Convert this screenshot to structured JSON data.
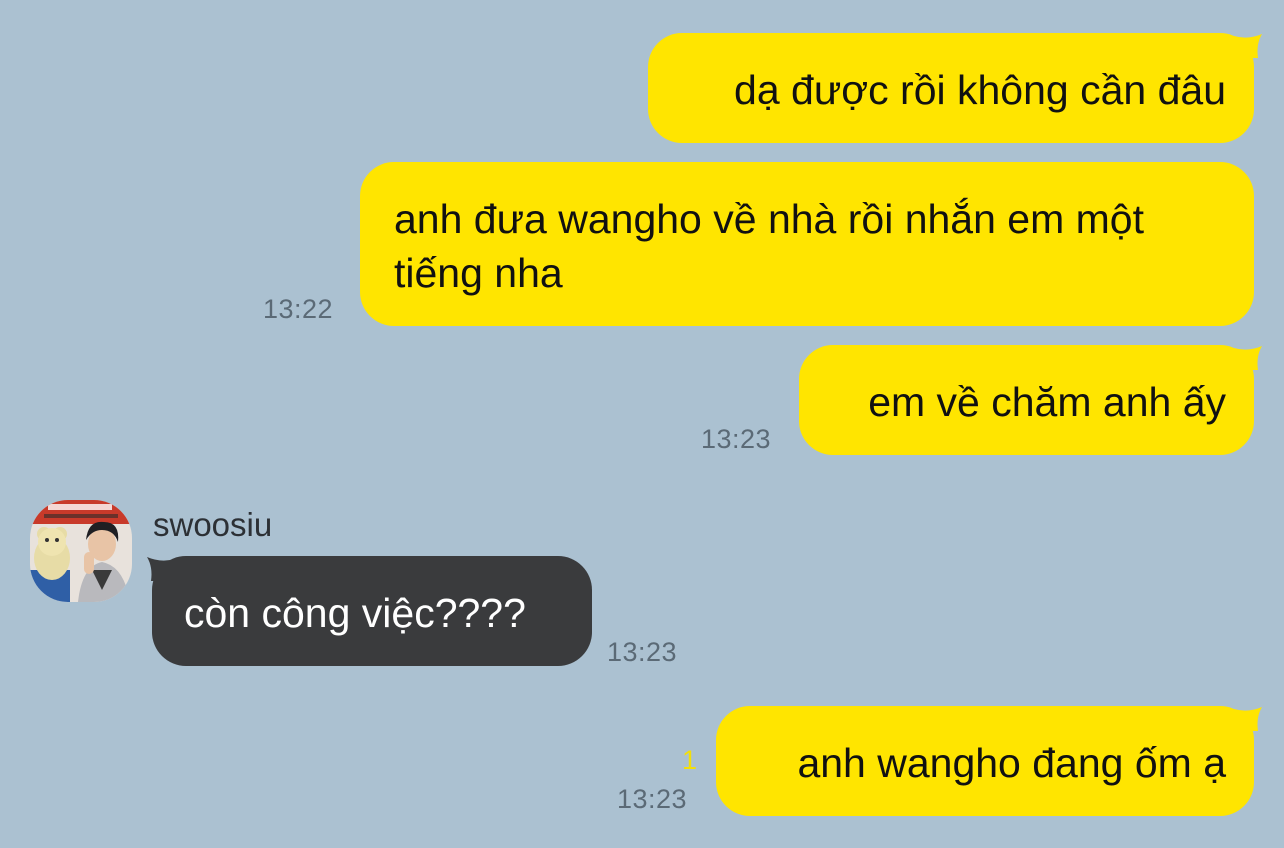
{
  "chat": {
    "background_color": "#abc1d1",
    "my_bubble_color": "#ffe500",
    "their_bubble_color": "#3a3b3d",
    "unread_color": "#f3df0a",
    "messages": [
      {
        "sender": "me",
        "text": "dạ được rồi không cần đâu",
        "time": ""
      },
      {
        "sender": "me",
        "text": "anh đưa wangho về nhà rồi nhắn em một tiếng nha",
        "time": "13:22"
      },
      {
        "sender": "me",
        "text": "em về chăm anh ấy",
        "time": "13:23"
      },
      {
        "sender": "swoosiu",
        "text": "còn công việc????",
        "time": "13:23"
      },
      {
        "sender": "me",
        "text": "anh wangho đang ốm ạ",
        "time": "13:23",
        "unread_count": "1"
      }
    ],
    "contact": {
      "name": "swoosiu",
      "avatar_icon": "profile-photo"
    }
  }
}
